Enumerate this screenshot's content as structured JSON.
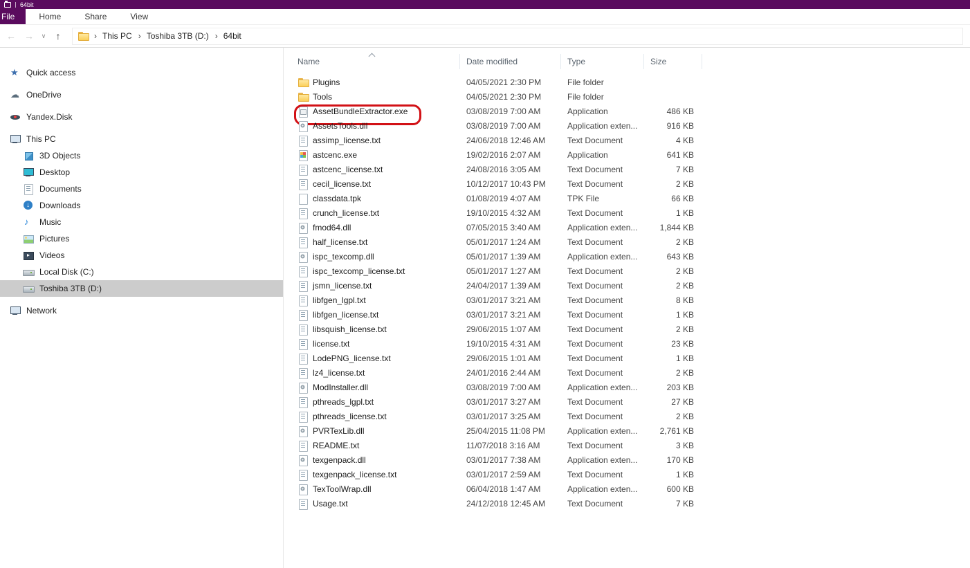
{
  "window": {
    "title": "64bit",
    "accent_color": "#5a0b5e"
  },
  "ribbon": {
    "file_tab": "File",
    "tabs": [
      {
        "label": "Home"
      },
      {
        "label": "Share"
      },
      {
        "label": "View"
      }
    ]
  },
  "toolbar": {
    "icons": {
      "back": "←",
      "forward": "→",
      "dropdown": "∨",
      "up": "↑"
    },
    "breadcrumb": [
      {
        "label": "This PC"
      },
      {
        "label": "Toshiba 3TB (D:)"
      },
      {
        "label": "64bit"
      }
    ]
  },
  "sidebar": {
    "items": [
      {
        "label": "Quick access",
        "icon": "star",
        "indent": 0
      },
      {
        "label": "OneDrive",
        "icon": "cloud",
        "indent": 0
      },
      {
        "label": "Yandex.Disk",
        "icon": "yandex-disk",
        "indent": 0
      },
      {
        "label": "This PC",
        "icon": "computer",
        "indent": 0
      },
      {
        "label": "3D Objects",
        "icon": "3d-objects",
        "indent": 1
      },
      {
        "label": "Desktop",
        "icon": "desktop",
        "indent": 1
      },
      {
        "label": "Documents",
        "icon": "documents",
        "indent": 1
      },
      {
        "label": "Downloads",
        "icon": "downloads",
        "indent": 1
      },
      {
        "label": "Music",
        "icon": "music",
        "indent": 1
      },
      {
        "label": "Pictures",
        "icon": "pictures",
        "indent": 1
      },
      {
        "label": "Videos",
        "icon": "videos",
        "indent": 1
      },
      {
        "label": "Local Disk (C:)",
        "icon": "drive",
        "indent": 1
      },
      {
        "label": "Toshiba 3TB (D:)",
        "icon": "drive",
        "indent": 1,
        "selected": true
      },
      {
        "label": "Network",
        "icon": "network",
        "indent": 0
      }
    ]
  },
  "filelist": {
    "columns": [
      {
        "label": "Name",
        "sort": "ascending"
      },
      {
        "label": "Date modified"
      },
      {
        "label": "Type"
      },
      {
        "label": "Size"
      }
    ],
    "rows": [
      {
        "name": "Plugins",
        "icon": "folder",
        "modified": "04/05/2021 2:30 PM",
        "type": "File folder",
        "size": ""
      },
      {
        "name": "Tools",
        "icon": "folder",
        "modified": "04/05/2021 2:30 PM",
        "type": "File folder",
        "size": ""
      },
      {
        "name": "AssetBundleExtractor.exe",
        "icon": "app",
        "modified": "03/08/2019 7:00 AM",
        "type": "Application",
        "size": "486 KB",
        "annotated": true
      },
      {
        "name": "AssetsTools.dll",
        "icon": "dll",
        "modified": "03/08/2019 7:00 AM",
        "type": "Application exten...",
        "size": "916 KB"
      },
      {
        "name": "assimp_license.txt",
        "icon": "txt",
        "modified": "24/06/2018 12:46 AM",
        "type": "Text Document",
        "size": "4 KB"
      },
      {
        "name": "astcenc.exe",
        "icon": "app-blue",
        "modified": "19/02/2016 2:07 AM",
        "type": "Application",
        "size": "641 KB"
      },
      {
        "name": "astcenc_license.txt",
        "icon": "txt",
        "modified": "24/08/2016 3:05 AM",
        "type": "Text Document",
        "size": "7 KB"
      },
      {
        "name": "cecil_license.txt",
        "icon": "txt",
        "modified": "10/12/2017 10:43 PM",
        "type": "Text Document",
        "size": "2 KB"
      },
      {
        "name": "classdata.tpk",
        "icon": "file",
        "modified": "01/08/2019 4:07 AM",
        "type": "TPK File",
        "size": "66 KB"
      },
      {
        "name": "crunch_license.txt",
        "icon": "txt",
        "modified": "19/10/2015 4:32 AM",
        "type": "Text Document",
        "size": "1 KB"
      },
      {
        "name": "fmod64.dll",
        "icon": "dll",
        "modified": "07/05/2015 3:40 AM",
        "type": "Application exten...",
        "size": "1,844 KB"
      },
      {
        "name": "half_license.txt",
        "icon": "txt",
        "modified": "05/01/2017 1:24 AM",
        "type": "Text Document",
        "size": "2 KB"
      },
      {
        "name": "ispc_texcomp.dll",
        "icon": "dll",
        "modified": "05/01/2017 1:39 AM",
        "type": "Application exten...",
        "size": "643 KB"
      },
      {
        "name": "ispc_texcomp_license.txt",
        "icon": "txt",
        "modified": "05/01/2017 1:27 AM",
        "type": "Text Document",
        "size": "2 KB"
      },
      {
        "name": "jsmn_license.txt",
        "icon": "txt",
        "modified": "24/04/2017 1:39 AM",
        "type": "Text Document",
        "size": "2 KB"
      },
      {
        "name": "libfgen_lgpl.txt",
        "icon": "txt",
        "modified": "03/01/2017 3:21 AM",
        "type": "Text Document",
        "size": "8 KB"
      },
      {
        "name": "libfgen_license.txt",
        "icon": "txt",
        "modified": "03/01/2017 3:21 AM",
        "type": "Text Document",
        "size": "1 KB"
      },
      {
        "name": "libsquish_license.txt",
        "icon": "txt",
        "modified": "29/06/2015 1:07 AM",
        "type": "Text Document",
        "size": "2 KB"
      },
      {
        "name": "license.txt",
        "icon": "txt",
        "modified": "19/10/2015 4:31 AM",
        "type": "Text Document",
        "size": "23 KB"
      },
      {
        "name": "LodePNG_license.txt",
        "icon": "txt",
        "modified": "29/06/2015 1:01 AM",
        "type": "Text Document",
        "size": "1 KB"
      },
      {
        "name": "lz4_license.txt",
        "icon": "txt",
        "modified": "24/01/2016 2:44 AM",
        "type": "Text Document",
        "size": "2 KB"
      },
      {
        "name": "ModInstaller.dll",
        "icon": "dll",
        "modified": "03/08/2019 7:00 AM",
        "type": "Application exten...",
        "size": "203 KB"
      },
      {
        "name": "pthreads_lgpl.txt",
        "icon": "txt",
        "modified": "03/01/2017 3:27 AM",
        "type": "Text Document",
        "size": "27 KB"
      },
      {
        "name": "pthreads_license.txt",
        "icon": "txt",
        "modified": "03/01/2017 3:25 AM",
        "type": "Text Document",
        "size": "2 KB"
      },
      {
        "name": "PVRTexLib.dll",
        "icon": "dll",
        "modified": "25/04/2015 11:08 PM",
        "type": "Application exten...",
        "size": "2,761 KB"
      },
      {
        "name": "README.txt",
        "icon": "txt",
        "modified": "11/07/2018 3:16 AM",
        "type": "Text Document",
        "size": "3 KB"
      },
      {
        "name": "texgenpack.dll",
        "icon": "dll",
        "modified": "03/01/2017 7:38 AM",
        "type": "Application exten...",
        "size": "170 KB"
      },
      {
        "name": "texgenpack_license.txt",
        "icon": "txt",
        "modified": "03/01/2017 2:59 AM",
        "type": "Text Document",
        "size": "1 KB"
      },
      {
        "name": "TexToolWrap.dll",
        "icon": "dll",
        "modified": "06/04/2018 1:47 AM",
        "type": "Application exten...",
        "size": "600 KB"
      },
      {
        "name": "Usage.txt",
        "icon": "txt",
        "modified": "24/12/2018 12:45 AM",
        "type": "Text Document",
        "size": "7 KB"
      }
    ]
  },
  "annotation": {
    "highlighted_file": "AssetBundleExtractor.exe",
    "color": "#d21116"
  }
}
